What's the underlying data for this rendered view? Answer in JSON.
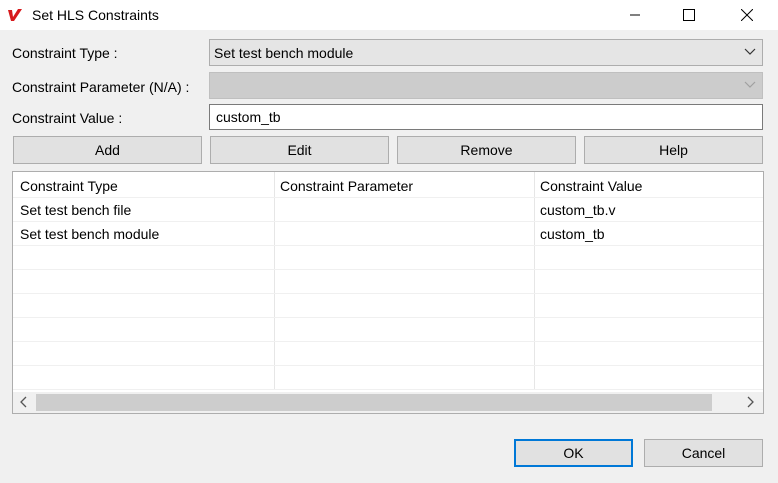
{
  "window": {
    "title": "Set HLS Constraints"
  },
  "form": {
    "type_label": "Constraint Type :",
    "type_value": "Set test bench module",
    "param_label": "Constraint Parameter (N/A) :",
    "param_value": "",
    "value_label": "Constraint Value :",
    "value_text": "custom_tb"
  },
  "actions": {
    "add": "Add",
    "edit": "Edit",
    "remove": "Remove",
    "help": "Help"
  },
  "table": {
    "columns": [
      "Constraint Type",
      "Constraint Parameter",
      "Constraint Value"
    ],
    "rows": [
      [
        "Set test bench file",
        "",
        "custom_tb.v"
      ],
      [
        "Set test bench module",
        "",
        "custom_tb"
      ]
    ]
  },
  "footer": {
    "ok": "OK",
    "cancel": "Cancel"
  },
  "colors": {
    "accent": "#0078d7",
    "logo": "#d7191c"
  }
}
